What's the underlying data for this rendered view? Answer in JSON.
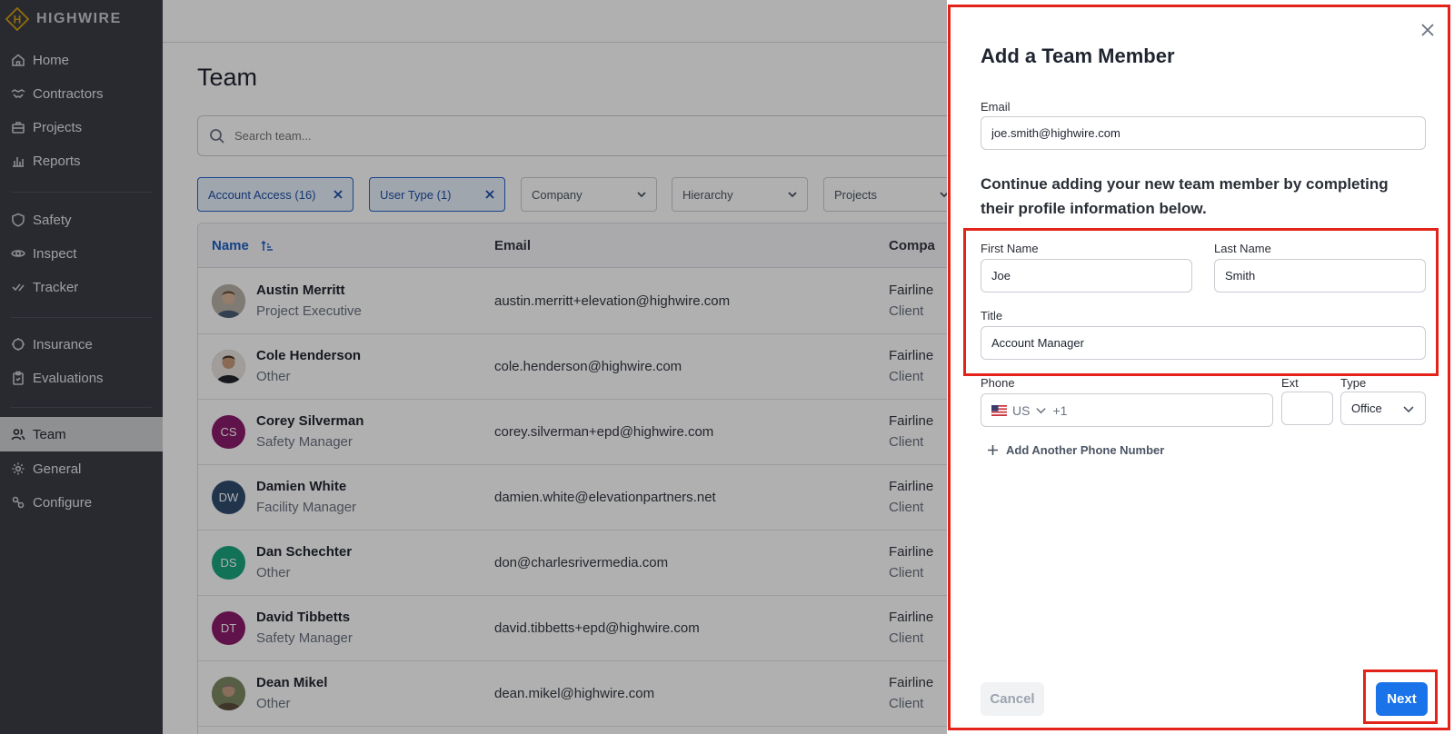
{
  "app": {
    "brand": "HIGHWIRE"
  },
  "sidebar": {
    "items": [
      {
        "label": "Home",
        "icon": "home-icon"
      },
      {
        "label": "Contractors",
        "icon": "handshake-icon"
      },
      {
        "label": "Projects",
        "icon": "briefcase-icon"
      },
      {
        "label": "Reports",
        "icon": "bar-chart-icon"
      },
      {
        "label": "Safety",
        "icon": "shield-icon"
      },
      {
        "label": "Inspect",
        "icon": "eye-icon"
      },
      {
        "label": "Tracker",
        "icon": "check-list-icon"
      },
      {
        "label": "Insurance",
        "icon": "umbrella-icon"
      },
      {
        "label": "Evaluations",
        "icon": "clipboard-icon"
      },
      {
        "label": "Team",
        "icon": "users-icon",
        "active": true
      },
      {
        "label": "General",
        "icon": "gear-icon"
      },
      {
        "label": "Configure",
        "icon": "configure-icon"
      }
    ]
  },
  "main": {
    "title": "Team",
    "search": {
      "placeholder": "Search team..."
    },
    "filters": [
      {
        "label": "Account Access (16)",
        "active": true
      },
      {
        "label": "User Type (1)",
        "active": true
      },
      {
        "label": "Company",
        "active": false
      },
      {
        "label": "Hierarchy",
        "active": false
      },
      {
        "label": "Projects",
        "active": false
      }
    ],
    "table": {
      "columns": [
        "Name",
        "Email",
        "Compa"
      ],
      "rows": [
        {
          "name": "Austin Merritt",
          "role": "Project Executive",
          "email": "austin.merritt+elevation@highwire.com",
          "company": "Fairline",
          "type": "Client",
          "initials": "",
          "avatar_color": "#8a7a6c"
        },
        {
          "name": "Cole Henderson",
          "role": "Other",
          "email": "cole.henderson@highwire.com",
          "company": "Fairline",
          "type": "Client",
          "initials": "",
          "avatar_color": "#5b4a3d"
        },
        {
          "name": "Corey Silverman",
          "role": "Safety Manager",
          "email": "corey.silverman+epd@highwire.com",
          "company": "Fairline",
          "type": "Client",
          "initials": "CS",
          "avatar_color": "#8b1c6c"
        },
        {
          "name": "Damien White",
          "role": "Facility Manager",
          "email": "damien.white@elevationpartners.net",
          "company": "Fairline",
          "type": "Client",
          "initials": "DW",
          "avatar_color": "#2f4c6e"
        },
        {
          "name": "Dan Schechter",
          "role": "Other",
          "email": "don@charlesrivermedia.com",
          "company": "Fairline",
          "type": "Client",
          "initials": "DS",
          "avatar_color": "#1aa57f"
        },
        {
          "name": "David Tibbetts",
          "role": "Safety Manager",
          "email": "david.tibbetts+epd@highwire.com",
          "company": "Fairline",
          "type": "Client",
          "initials": "DT",
          "avatar_color": "#8b1c6c"
        },
        {
          "name": "Dean Mikel",
          "role": "Other",
          "email": "dean.mikel@highwire.com",
          "company": "Fairline",
          "type": "Client",
          "initials": "",
          "avatar_color": "#6b6a52"
        }
      ]
    }
  },
  "drawer": {
    "title": "Add a Team Member",
    "email_label": "Email",
    "email_value": "joe.smith@highwire.com",
    "instructions": "Continue adding your new team member by completing their profile information below.",
    "first_name_label": "First Name",
    "first_name_value": "Joe",
    "last_name_label": "Last Name",
    "last_name_value": "Smith",
    "title_label": "Title",
    "title_value": "Account Manager",
    "phone_label": "Phone",
    "phone_country": "US",
    "phone_prefix": "+1",
    "ext_label": "Ext",
    "type_label": "Type",
    "type_value": "Office",
    "add_phone_label": "Add Another Phone Number",
    "cancel_label": "Cancel",
    "next_label": "Next"
  },
  "colors": {
    "highlight": "#e3231a",
    "primary": "#1a73e8",
    "sidebar": "#3a3d45"
  }
}
